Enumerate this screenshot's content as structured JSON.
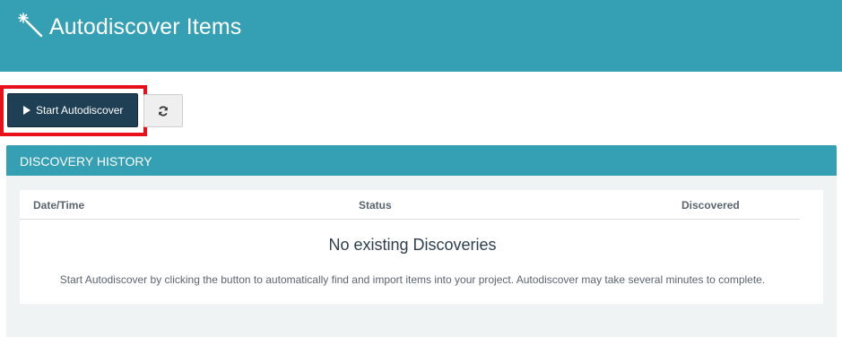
{
  "header": {
    "title": "Autodiscover Items",
    "icon": "magic-wand-icon",
    "background": "#35a0b3"
  },
  "toolbar": {
    "start_label": "Start Autodiscover",
    "start_icon": "play-icon",
    "refresh_icon": "refresh-icon",
    "highlight_color": "#e8101a"
  },
  "history": {
    "title": "DISCOVERY HISTORY",
    "columns": [
      "Date/Time",
      "Status",
      "Discovered"
    ],
    "empty_title": "No existing Discoveries",
    "empty_message": "Start Autodiscover by clicking the button to automatically find and import items into your project. Autodiscover may take several minutes to complete."
  }
}
